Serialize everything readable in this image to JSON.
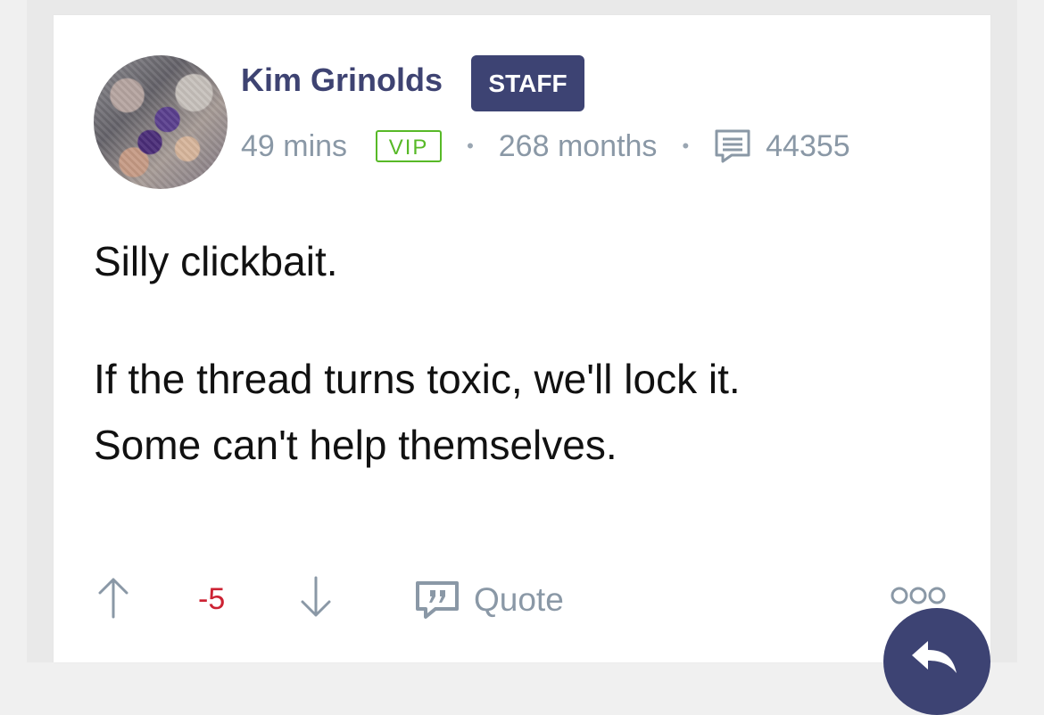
{
  "post": {
    "author": "Kim Grinolds",
    "badge": "STAFF",
    "time": "49 mins",
    "vip_label": "VIP",
    "tenure": "268 months",
    "comment_count": "44355",
    "body": {
      "line1": "Silly clickbait.",
      "line2": "If the thread turns toxic, we'll lock it.",
      "line3": "Some can't help themselves."
    }
  },
  "actions": {
    "score": "-5",
    "quote_label": "Quote"
  },
  "icons": {
    "upvote": "arrow-up-icon",
    "downvote": "arrow-down-icon",
    "comments": "comment-icon",
    "quote": "quote-icon",
    "more": "more-options-icon",
    "reply": "reply-icon"
  },
  "colors": {
    "brand": "#3d4373",
    "vip_green": "#57b927",
    "score_red": "#cc2233",
    "meta_gray": "#8a98a6"
  }
}
